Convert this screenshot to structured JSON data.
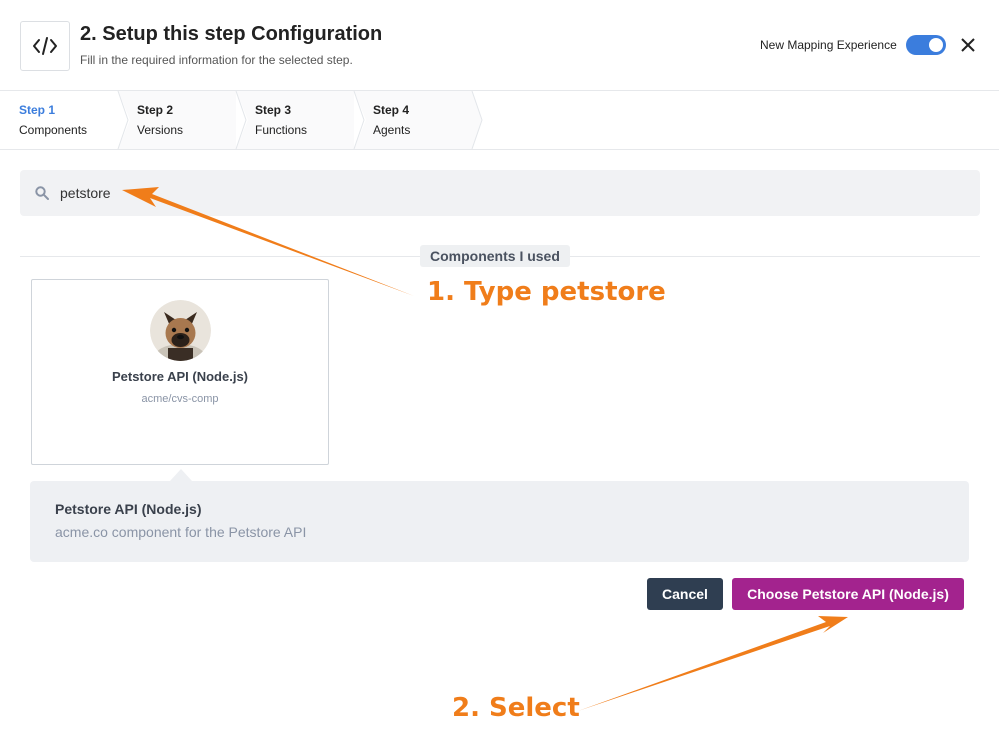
{
  "header": {
    "title": "2. Setup this step Configuration",
    "subtitle": "Fill in the required information for the selected step.",
    "mapping_label": "New Mapping Experience",
    "mapping_enabled": true
  },
  "steps": [
    {
      "num": "Step 1",
      "label": "Components",
      "active": true
    },
    {
      "num": "Step 2",
      "label": "Versions",
      "active": false
    },
    {
      "num": "Step 3",
      "label": "Functions",
      "active": false
    },
    {
      "num": "Step 4",
      "label": "Agents",
      "active": false
    }
  ],
  "search": {
    "value": "petstore",
    "icon": "search-icon"
  },
  "section_label": "Components I used",
  "card": {
    "title": "Petstore API (Node.js)",
    "subtitle": "acme/cvs-comp"
  },
  "detail": {
    "title": "Petstore API (Node.js)",
    "description": "acme.co component for the Petstore API"
  },
  "buttons": {
    "cancel": "Cancel",
    "choose": "Choose Petstore API (Node.js)"
  },
  "annotations": {
    "type": "1. Type petstore",
    "select": "2. Select"
  },
  "colors": {
    "accent": "#3b7ddd",
    "primary_button": "#a3238e",
    "cancel_button": "#2f3e51",
    "annotation": "#f07d1a"
  }
}
